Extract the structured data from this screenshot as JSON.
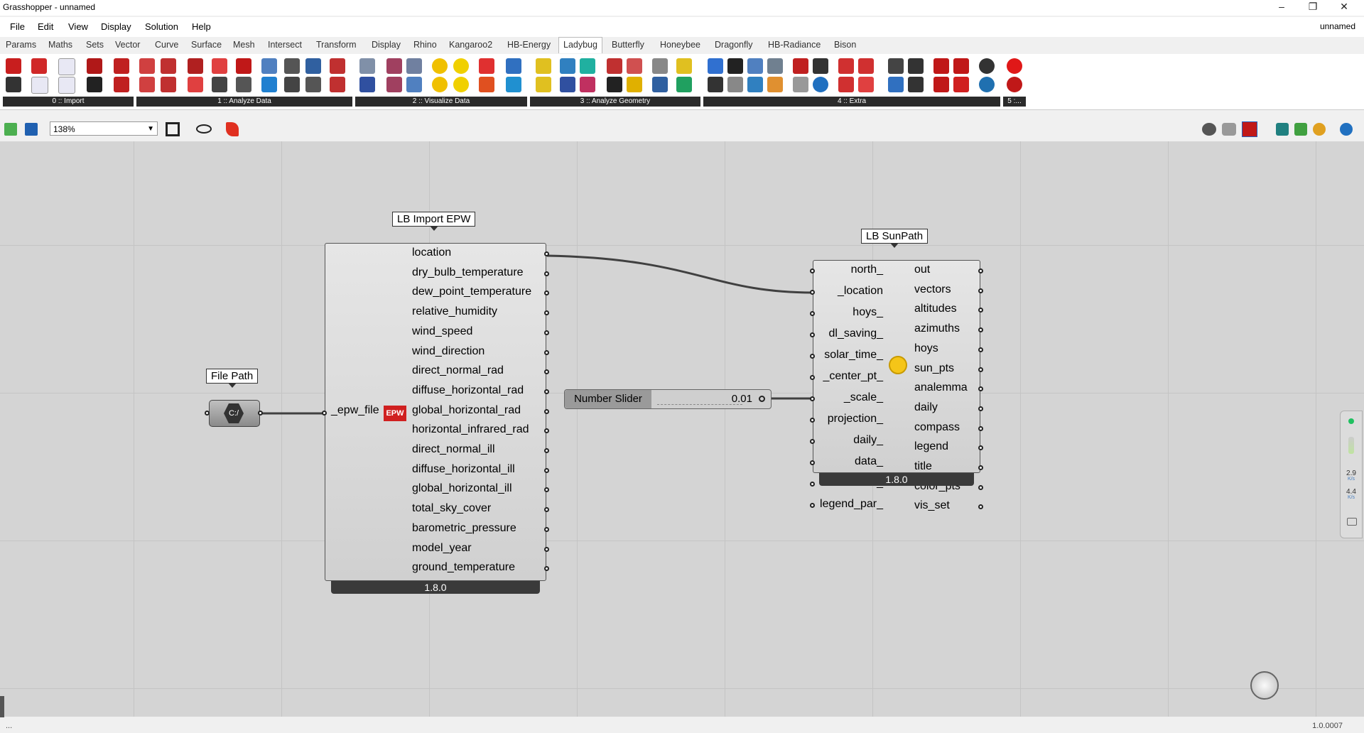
{
  "window": {
    "title": "Grasshopper - unnamed",
    "document_name": "unnamed",
    "controls": [
      "–",
      "❐",
      "✕"
    ]
  },
  "menu": [
    "File",
    "Edit",
    "View",
    "Display",
    "Solution",
    "Help"
  ],
  "tabs": [
    "Params",
    "Maths",
    "Sets",
    "Vector",
    "Curve",
    "Surface",
    "Mesh",
    "Intersect",
    "Transform",
    "Display",
    "Rhino",
    "Kangaroo2",
    "HB-Energy",
    "Ladybug",
    "Butterfly",
    "Honeybee",
    "Dragonfly",
    "HB-Radiance",
    "Bison"
  ],
  "active_tab": "Ladybug",
  "ribbon_groups": [
    "0 :: Import",
    "1 :: Analyze Data",
    "2 :: Visualize Data",
    "3 :: Analyze Geometry",
    "4 :: Extra",
    "5 :..."
  ],
  "toolbar": {
    "zoom": "138%"
  },
  "file_path": {
    "label": "File Path",
    "icon_text": "C:/"
  },
  "import_epw": {
    "label": "LB Import EPW",
    "input": "_epw_file",
    "badge": "EPW",
    "outputs": [
      "location",
      "dry_bulb_temperature",
      "dew_point_temperature",
      "relative_humidity",
      "wind_speed",
      "wind_direction",
      "direct_normal_rad",
      "diffuse_horizontal_rad",
      "global_horizontal_rad",
      "horizontal_infrared_rad",
      "direct_normal_ill",
      "diffuse_horizontal_ill",
      "global_horizontal_ill",
      "total_sky_cover",
      "barometric_pressure",
      "model_year",
      "ground_temperature"
    ],
    "version": "1.8.0"
  },
  "slider": {
    "label": "Number Slider",
    "value": "0.01"
  },
  "sunpath": {
    "label": "LB SunPath",
    "inputs": [
      "north_",
      "_location",
      "hoys_",
      "dl_saving_",
      "solar_time_",
      "_center_pt_",
      "_scale_",
      "projection_",
      "daily_",
      "data_",
      "statement_",
      "legend_par_"
    ],
    "outputs": [
      "out",
      "vectors",
      "altitudes",
      "azimuths",
      "hoys",
      "sun_pts",
      "analemma",
      "daily",
      "compass",
      "legend",
      "title",
      "color_pts",
      "vis_set"
    ],
    "version": "1.8.0"
  },
  "side_widget": {
    "value1": "2.9",
    "unit1": "K/s",
    "value2": "4.4",
    "unit2": "K/s"
  },
  "status": {
    "left": "...",
    "version": "1.0.0007"
  },
  "colors": {
    "canvas": "#d4d4d4",
    "component": "#dcdcdc",
    "version_bar": "#3a3a3a",
    "wire": "#404040"
  }
}
